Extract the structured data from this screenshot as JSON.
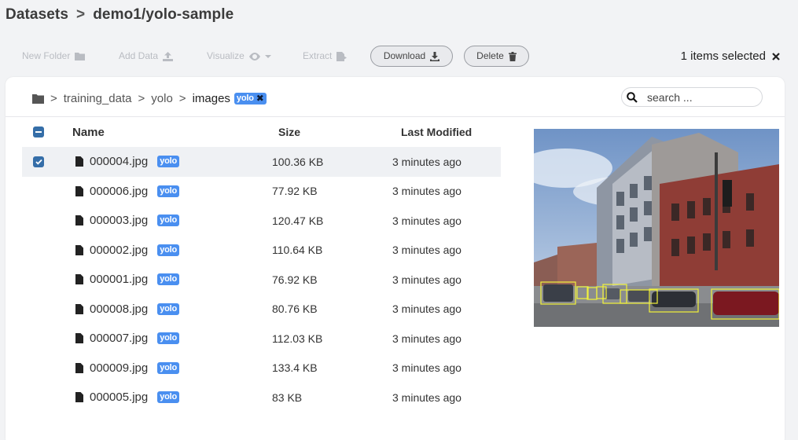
{
  "header": {
    "root": "Datasets",
    "separator": ">",
    "dataset": "demo1/yolo-sample"
  },
  "toolbar": {
    "new_folder": "New Folder",
    "add_data": "Add Data",
    "visualize": "Visualize",
    "extract": "Extract",
    "download": "Download",
    "delete": "Delete",
    "selected_text": "1 items selected"
  },
  "breadcrumb": {
    "items": [
      "training_data",
      "yolo"
    ],
    "current": "images",
    "tag": "yolo"
  },
  "search": {
    "placeholder": "search ..."
  },
  "table": {
    "columns": [
      "Name",
      "Size",
      "Last Modified"
    ],
    "rows": [
      {
        "name": "000004.jpg",
        "tag": "yolo",
        "size": "100.36 KB",
        "modified": "3 minutes ago",
        "selected": true
      },
      {
        "name": "000006.jpg",
        "tag": "yolo",
        "size": "77.92 KB",
        "modified": "3 minutes ago",
        "selected": false
      },
      {
        "name": "000003.jpg",
        "tag": "yolo",
        "size": "120.47 KB",
        "modified": "3 minutes ago",
        "selected": false
      },
      {
        "name": "000002.jpg",
        "tag": "yolo",
        "size": "110.64 KB",
        "modified": "3 minutes ago",
        "selected": false
      },
      {
        "name": "000001.jpg",
        "tag": "yolo",
        "size": "76.92 KB",
        "modified": "3 minutes ago",
        "selected": false
      },
      {
        "name": "000008.jpg",
        "tag": "yolo",
        "size": "80.76 KB",
        "modified": "3 minutes ago",
        "selected": false
      },
      {
        "name": "000007.jpg",
        "tag": "yolo",
        "size": "112.03 KB",
        "modified": "3 minutes ago",
        "selected": false
      },
      {
        "name": "000009.jpg",
        "tag": "yolo",
        "size": "133.4 KB",
        "modified": "3 minutes ago",
        "selected": false
      },
      {
        "name": "000005.jpg",
        "tag": "yolo",
        "size": "83 KB",
        "modified": "3 minutes ago",
        "selected": false
      }
    ]
  },
  "colors": {
    "tag_bg": "#4a8ff0",
    "checkbox": "#356ea8",
    "bbox": "#f2f23a"
  },
  "icons": [
    "folder-icon",
    "download-icon",
    "trash-icon",
    "eye-icon",
    "file-icon",
    "search-icon",
    "close-icon"
  ]
}
